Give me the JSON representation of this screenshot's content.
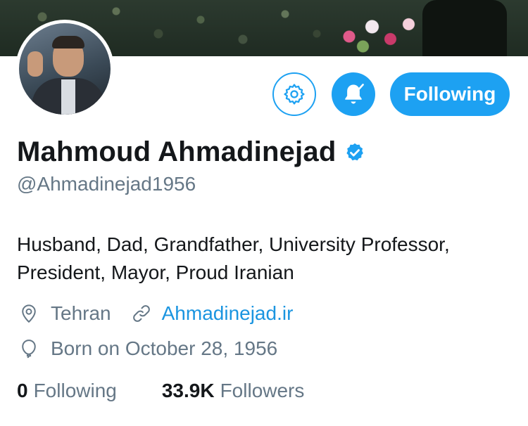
{
  "profile": {
    "display_name": "Mahmoud Ahmadinejad",
    "verified": true,
    "handle": "@Ahmadinejad1956",
    "bio": "Husband, Dad, Grandfather, University Professor, President, Mayor, Proud Iranian",
    "location": "Tehran",
    "website": "Ahmadinejad.ir",
    "born": "Born on October 28, 1956"
  },
  "actions": {
    "settings_icon": "gear-icon",
    "notifications_icon": "bell-check-icon",
    "follow_label": "Following"
  },
  "stats": {
    "following_count": "0",
    "following_label": "Following",
    "followers_count": "33.9K",
    "followers_label": "Followers"
  },
  "colors": {
    "accent": "#1da1f2",
    "link": "#1b95e0",
    "muted": "#657786",
    "text": "#14171a"
  },
  "icons": {
    "location": "map-pin-icon",
    "website": "link-icon",
    "birthday": "balloon-icon",
    "verified": "verified-badge-icon"
  }
}
